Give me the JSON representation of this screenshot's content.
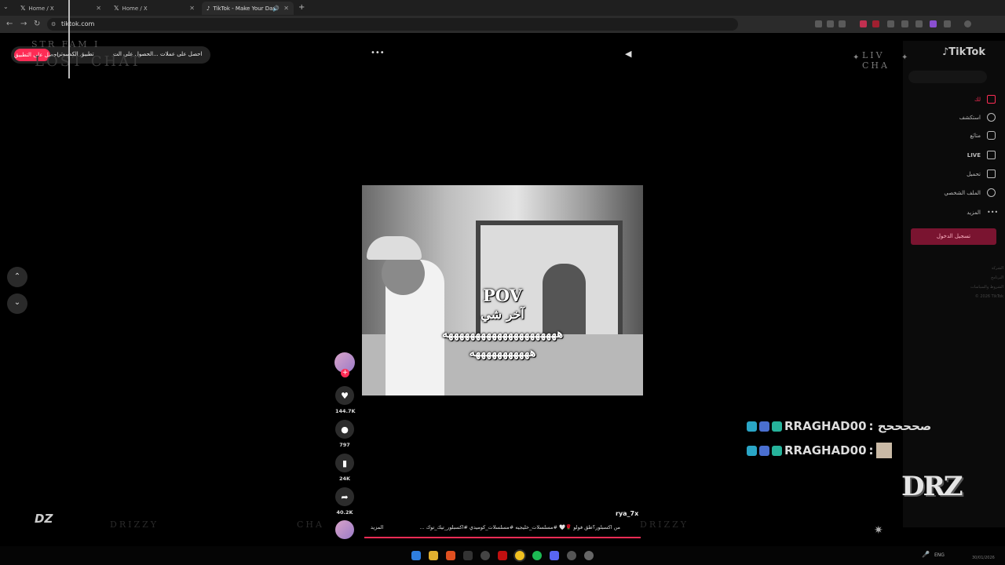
{
  "browser": {
    "tabs": [
      {
        "title": "Home / X",
        "icon": "x-logo-icon"
      },
      {
        "title": "Home / X",
        "icon": "x-logo-icon"
      },
      {
        "title": "TikTok - Make Your Day",
        "icon": "tiktok-icon"
      }
    ],
    "new_tab_label": "+",
    "url": "tiktok.com"
  },
  "header": {
    "get_app_label": "احصل على التطبيق",
    "promo_items": [
      "احصل على عملات",
      "الحصول على الت...",
      "تطبيق الكمبيوتر",
      "احصل على التطبيق"
    ],
    "more_label": "•••"
  },
  "sidebar": {
    "logo": "TikTok",
    "items": [
      {
        "label": "لك",
        "icon": "home-icon"
      },
      {
        "label": "استكشف",
        "icon": "compass-icon"
      },
      {
        "label": "متابَع",
        "icon": "following-icon"
      },
      {
        "label": "LIVE",
        "icon": "live-icon"
      },
      {
        "label": "تحميل",
        "icon": "upload-icon"
      },
      {
        "label": "الملف الشخصي",
        "icon": "profile-icon"
      },
      {
        "label": "المزيد",
        "icon": "more-icon"
      }
    ],
    "login_label": "تسجيل الدخول",
    "footer": [
      "الشركة",
      "البرنامج",
      "الشروط والسياسات",
      "© 2026 TikTok"
    ]
  },
  "video": {
    "overlay_title": "POV",
    "overlay_line1": "آخر شي",
    "overlay_line2": "هههههههههههههههههههههه",
    "overlay_line3": "هههههههههههه"
  },
  "actions": {
    "likes": "144.7K",
    "comments": "797",
    "saves": "24K",
    "shares": "40.2K"
  },
  "post": {
    "username": "rya_7x",
    "caption": "من اكسبلور؟ظق فولو 🌹🤍 #مسلسلات_خليجيه #مسلسلات_كوميدي #اكسبلور_تيك_توك ...",
    "more_label": "المزيد"
  },
  "stream_overlay": {
    "chat": [
      {
        "user": "RRAGHAD00",
        "message": ": صححححح"
      },
      {
        "user": "RRAGHAD00",
        "message": ":"
      }
    ],
    "logo_text": "DRZ"
  },
  "taskbar": {
    "lang": "ENG",
    "date": "30/01/2026"
  },
  "colors": {
    "accent": "#fe2c55",
    "background": "#000000",
    "chat_badge": "#2aa6c7"
  }
}
